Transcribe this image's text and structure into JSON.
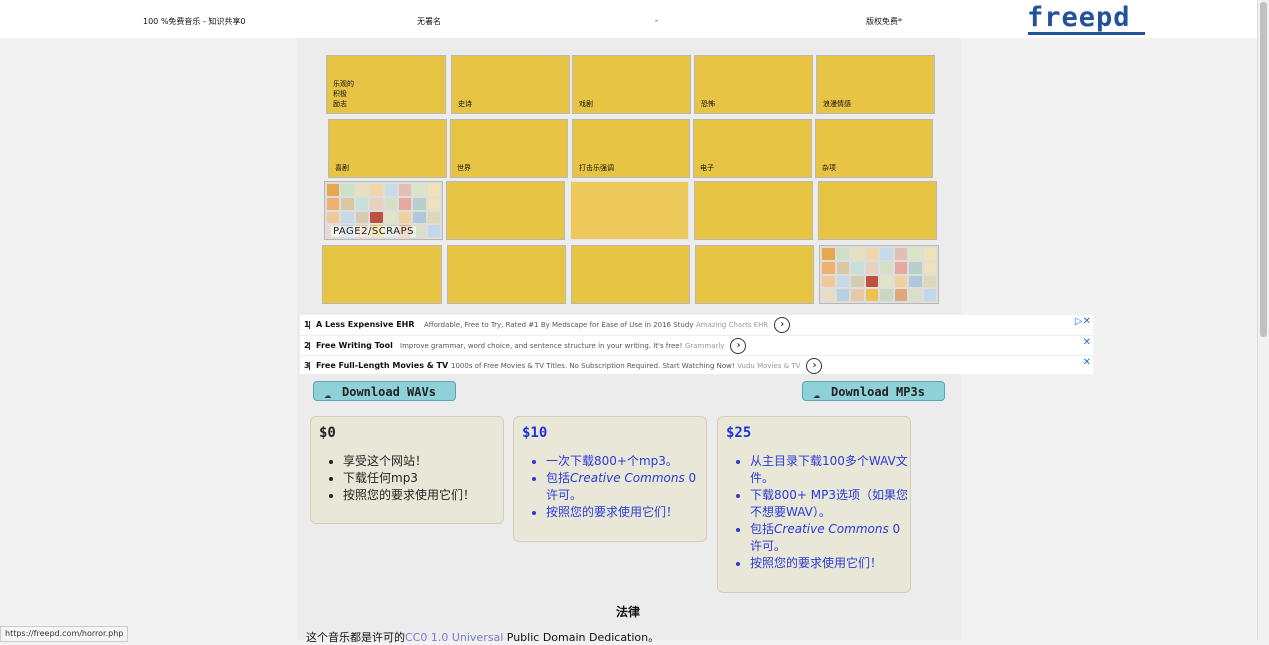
{
  "topbar": {
    "left_text": "100 %免费音乐 - 知识共享0",
    "author": "无署名",
    "dash": "-",
    "copyright": "版权免费*",
    "logo": "freepd"
  },
  "tiles": [
    {
      "label": "乐观的\n积极\n励志"
    },
    {
      "label": "史诗"
    },
    {
      "label": "戏剧"
    },
    {
      "label": "恐怖"
    },
    {
      "label": "浪漫情感"
    },
    {
      "label": "喜剧"
    },
    {
      "label": "世界"
    },
    {
      "label": "打击乐强调"
    },
    {
      "label": "电子"
    },
    {
      "label": "杂项"
    }
  ],
  "scraps_caption": "PAGE2/SCRAPS",
  "mosaic_colors": [
    "#e6a84a",
    "#cfe0c8",
    "#e8dfc0",
    "#f1d7a8",
    "#c7dbe8",
    "#e0c0b0",
    "#d6e6c7",
    "#f2e0b7",
    "#f0b070",
    "#d8c8a8",
    "#c9e0d8",
    "#e7d2c2",
    "#d2e3c5",
    "#e8a8a0",
    "#b7d0c8",
    "#efe2b8",
    "#f2c89a",
    "#c7d8e8",
    "#d4cdb0",
    "#c05040",
    "#e2e2c8",
    "#f0d0a0",
    "#b0c8d8",
    "#dcd8b8",
    "#e8dcc8",
    "#b8d0e0",
    "#e8c8a8",
    "#f0c050",
    "#c8d8c0",
    "#e0a878",
    "#d8e0c8",
    "#c0d8e8"
  ],
  "ads": [
    {
      "num": "1",
      "title": "A Less Expensive EHR",
      "desc": "Affordable, Free to Try, Rated #1 By Medscape for Ease of Use in 2016 Study",
      "src": "Amazing Charts EHR",
      "go": "›",
      "close": "▷✕"
    },
    {
      "num": "2",
      "title": "Free Writing Tool",
      "desc": "Improve grammar, word choice, and sentence structure in your writing. It's free!",
      "src": "Grammarly",
      "go": "›",
      "close": "✕"
    },
    {
      "num": "3",
      "title": "Free Full-Length Movies & TV",
      "desc": "1000s of Free Movies & TV Titles. No Subscription Required. Start Watching Now!",
      "src": "Vudu Movies & TV",
      "go": "›",
      "close": "✕"
    }
  ],
  "buttons": {
    "wav": "Download WAVs",
    "mp3": "Download MP3s",
    "icon": "☁"
  },
  "cards": [
    {
      "price": "$0",
      "items": [
        "享受这个网站！",
        "下载任何mp3",
        "按照您的要求使用它们！"
      ]
    },
    {
      "price": "$10",
      "items": [
        "一次下载800+个mp3。",
        "包括Creative Commons 0许可。",
        "按照您的要求使用它们！"
      ]
    },
    {
      "price": "$25",
      "items": [
        "从主目录下载100多个WAV文件。",
        "下载800+ MP3选项（如果您不想要WAV）。",
        "包括Creative Commons 0许可。",
        "按照您的要求使用它们！"
      ]
    }
  ],
  "legal": {
    "heading": "法律",
    "text_pre": "这个音乐都是许可的",
    "link": "CC0 1.0 Universal",
    "text_post": " Public Domain Dedication。"
  },
  "status_url": "https://freepd.com/horror.php"
}
